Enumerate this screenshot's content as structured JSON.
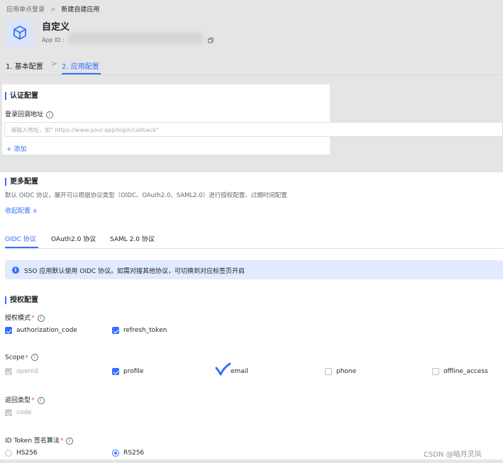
{
  "breadcrumb": {
    "parent": "应用单点登录",
    "separator": ">",
    "current": "新建自建应用"
  },
  "app": {
    "name": "自定义",
    "app_id_label": "App ID :",
    "icon": "cube-icon"
  },
  "steps": [
    {
      "label": "1. 基本配置"
    },
    {
      "label": "2. 应用配置"
    }
  ],
  "step_separator": ">",
  "auth_config": {
    "title": "认证配置",
    "callback_label": "登录回调地址",
    "callback_placeholder": "请输入地址，如\" https://www.your.app/login/callback\"",
    "add_label": "+ 添加"
  },
  "more_config": {
    "title": "更多配置",
    "description": "默认 OIDC 协议，展开可以根据协议类型（OIDC、OAuth2.0、SAML2.0）进行授权配置、过期时间配置",
    "collapse_label": "收起配置 ∧"
  },
  "protocol_tabs": [
    {
      "label": "OIDC 协议",
      "active": true
    },
    {
      "label": "OAuth2.0 协议",
      "active": false
    },
    {
      "label": "SAML 2.0 协议",
      "active": false
    }
  ],
  "alert": {
    "text": "SSO 应用默认使用 OIDC 协议。如需对接其他协议，可切换到对应标签页开启"
  },
  "authorization": {
    "title": "授权配置",
    "grant_mode": {
      "label": "授权模式",
      "options": [
        {
          "label": "authorization_code",
          "state": "checked"
        },
        {
          "label": "refresh_token",
          "state": "checked"
        }
      ]
    },
    "scope": {
      "label": "Scope",
      "options": [
        {
          "label": "openid",
          "state": "disabled"
        },
        {
          "label": "profile",
          "state": "checked"
        },
        {
          "label": "email",
          "state": "checked"
        },
        {
          "label": "phone",
          "state": "unchecked"
        },
        {
          "label": "offline_access",
          "state": "unchecked"
        }
      ]
    },
    "response_type": {
      "label": "返回类型",
      "options": [
        {
          "label": "code",
          "state": "disabled"
        }
      ]
    },
    "id_token_alg": {
      "label": "ID Token 签名算法",
      "options": [
        {
          "label": "HS256",
          "selected": false
        },
        {
          "label": "RS256",
          "selected": true
        }
      ]
    }
  },
  "watermark": "CSDN @暗月灵风",
  "colors": {
    "accent": "#3370ff",
    "overlay": "#e5e5e5",
    "alert_bg": "#e1eaff",
    "required": "#f54a45"
  }
}
